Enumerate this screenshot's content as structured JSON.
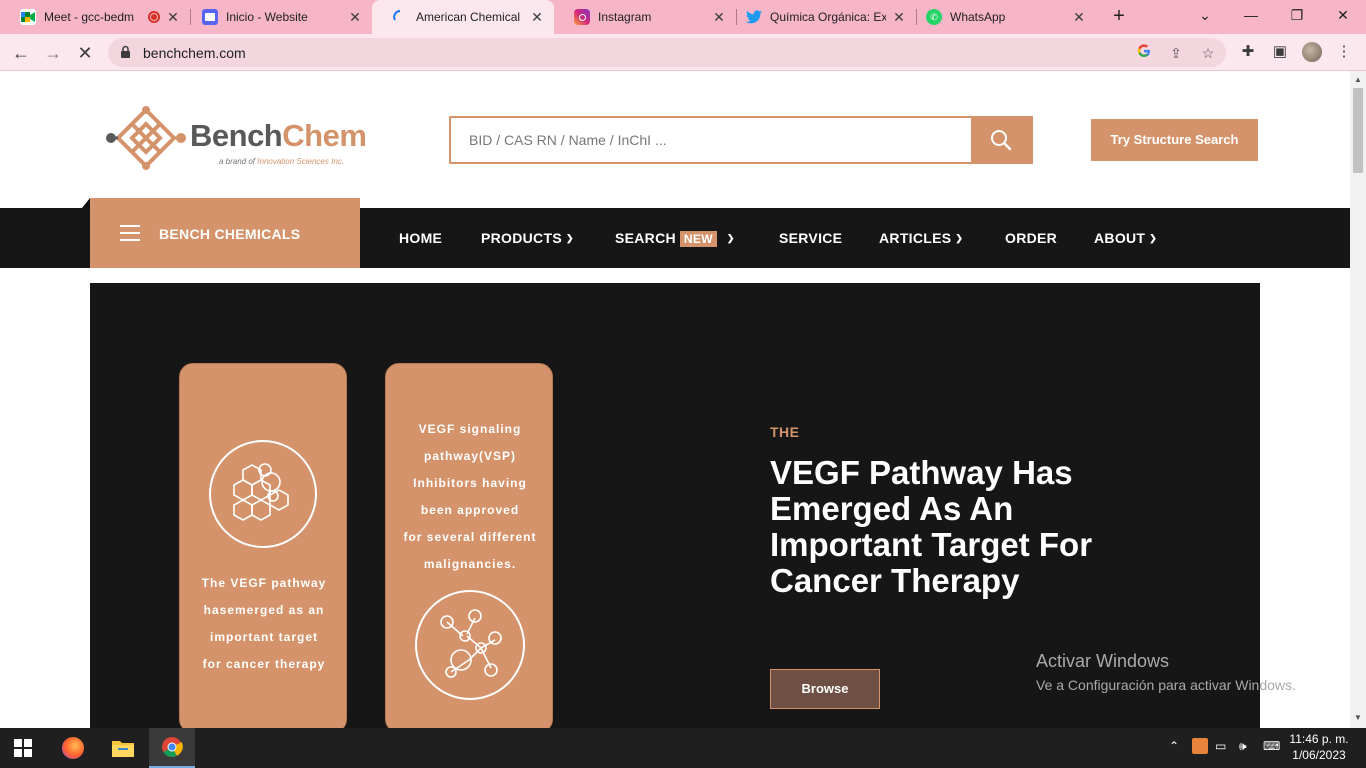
{
  "browser": {
    "tabs": [
      {
        "title": "Meet - gcc-bedm",
        "icon": "google-meet-icon"
      },
      {
        "title": "Inicio - Website",
        "icon": "calendar-icon"
      },
      {
        "title": "American Chemical Su",
        "icon": "loading-spinner-icon",
        "active": true
      },
      {
        "title": "Instagram",
        "icon": "instagram-icon"
      },
      {
        "title": "Química Orgánica: Exp",
        "icon": "twitter-icon"
      },
      {
        "title": "WhatsApp",
        "icon": "whatsapp-icon"
      }
    ],
    "url": "benchchem.com"
  },
  "header": {
    "logo_main": "Bench",
    "logo_accent": "Chem",
    "logo_tag_prefix": "a brand of",
    "logo_tag_company": "Innovation Sciences Inc.",
    "search_placeholder": "BID / CAS RN / Name / InChI ...",
    "structure_button": "Try Structure Search"
  },
  "nav": {
    "categories_label": "BENCH CHEMICALS",
    "items": {
      "home": "HOME",
      "products": "PRODUCTS",
      "search": "SEARCH",
      "search_badge": "NEW",
      "service": "SERVICE",
      "articles": "ARTICLES",
      "order": "ORDER",
      "about": "ABOUT"
    }
  },
  "hero": {
    "card1_lines": [
      "The VEGF pathway",
      "hasemerged as an",
      "important target",
      "for cancer therapy"
    ],
    "card2_lines": [
      "VEGF signaling",
      "pathway(VSP)",
      "Inhibitors having",
      "been approved",
      "for several different",
      "malignancies."
    ],
    "kicker": "THE",
    "headline": "VEGF Pathway Has Emerged As An Important Target For Cancer Therapy",
    "button": "Browse"
  },
  "watermark": {
    "line1": "Activar Windows",
    "line2": "Ve a Configuración para activar Windows."
  },
  "taskbar": {
    "time": "11:46 p. m.",
    "date": "1/06/2023"
  },
  "colors": {
    "accent": "#d4936a",
    "dark": "#161616",
    "tabstrip": "#f7b5c8"
  }
}
